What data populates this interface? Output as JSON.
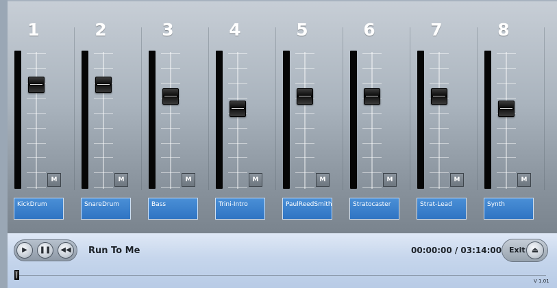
{
  "mixer": {
    "channels": [
      {
        "number": "1",
        "name": "KickDrum",
        "fader_level": 0.8,
        "mute_label": "M"
      },
      {
        "number": "2",
        "name": "SnareDrum",
        "fader_level": 0.8,
        "mute_label": "M"
      },
      {
        "number": "3",
        "name": "Bass",
        "fader_level": 0.7,
        "mute_label": "M"
      },
      {
        "number": "4",
        "name": "Trini-Intro",
        "fader_level": 0.6,
        "mute_label": "M"
      },
      {
        "number": "5",
        "name": "PaulReedSmith",
        "fader_level": 0.7,
        "mute_label": "M"
      },
      {
        "number": "6",
        "name": "Stratocaster",
        "fader_level": 0.7,
        "mute_label": "M"
      },
      {
        "number": "7",
        "name": "Strat-Lead",
        "fader_level": 0.7,
        "mute_label": "M"
      },
      {
        "number": "8",
        "name": "Synth",
        "fader_level": 0.6,
        "mute_label": "M"
      }
    ]
  },
  "transport": {
    "play_icon": "play-icon",
    "pause_icon": "pause-icon",
    "rewind_icon": "rewind-icon",
    "song_title": "Run To Me",
    "time_display": "00:00:00 / 03:14:00",
    "exit_label": "Exit",
    "eject_icon": "eject-icon",
    "progress": 0.0,
    "version": "V 1.01"
  },
  "colors": {
    "track_name_bg": "#3a80cc",
    "meter_bg": "#060606",
    "transport_bg": "#c6d6ec"
  }
}
